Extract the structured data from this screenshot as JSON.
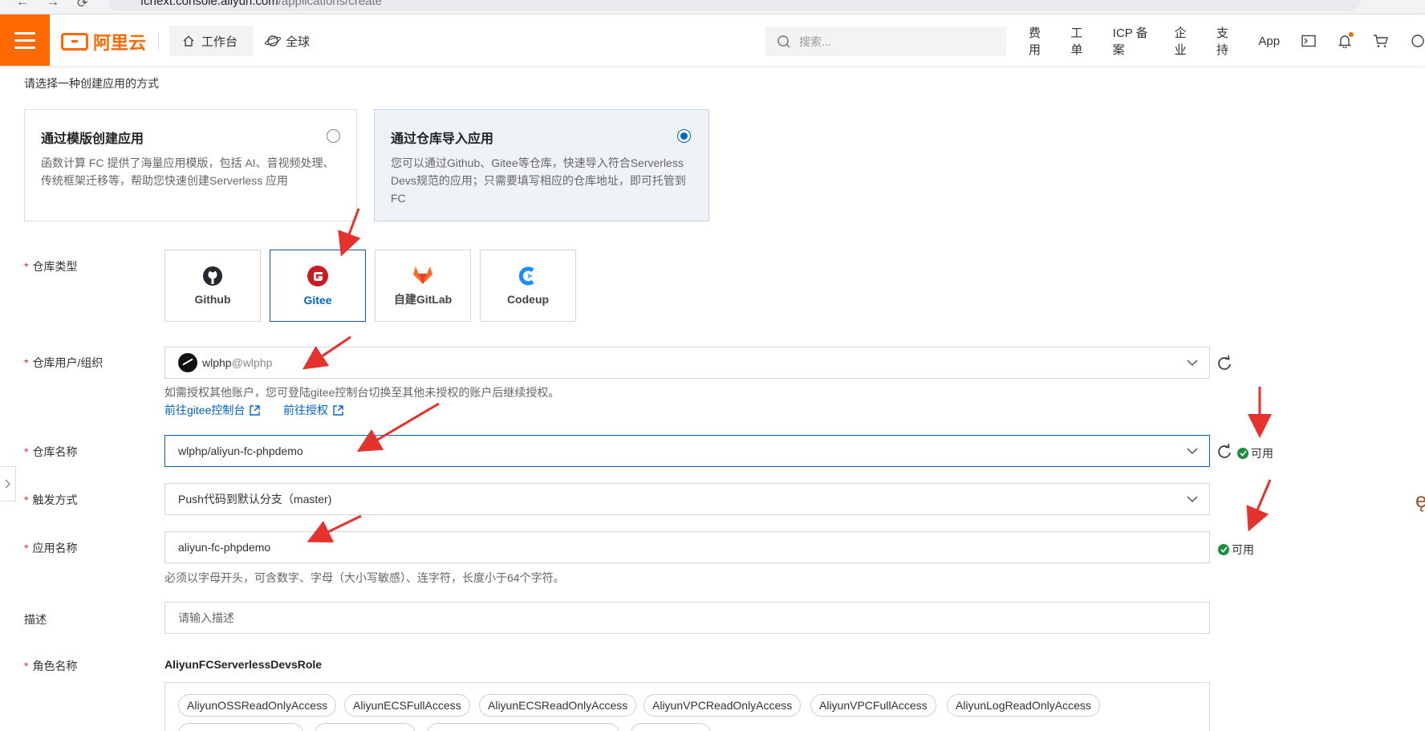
{
  "browser": {
    "url_host": "fcnext.console.aliyun.com",
    "url_path": "/applications/create"
  },
  "topbar": {
    "logo_text": "阿里云",
    "workbench_label": "工作台",
    "global_label": "全球",
    "search_placeholder": "搜索...",
    "nav": [
      "费用",
      "工单",
      "ICP 备案",
      "企业",
      "支持",
      "App"
    ],
    "brand_color": "#ff6a00"
  },
  "form": {
    "hint": "请选择一种创建应用的方式",
    "methods": [
      {
        "title": "通过模版创建应用",
        "desc": "函数计算 FC 提供了海量应用模版，包括 AI、音视频处理、传统框架迁移等，帮助您快速创建Serverless 应用",
        "selected": false
      },
      {
        "title": "通过仓库导入应用",
        "desc": "您可以通过Github、Gitee等仓库，快速导入符合Serverless Devs规范的应用；只需要填写相应的仓库地址，即可托管到 FC",
        "selected": true
      }
    ],
    "repo_type": {
      "label": "仓库类型",
      "options": [
        {
          "name": "Github",
          "icon": "github-icon",
          "selected": false
        },
        {
          "name": "Gitee",
          "icon": "gitee-icon",
          "selected": true
        },
        {
          "name": "自建GitLab",
          "icon": "gitlab-icon",
          "selected": false
        },
        {
          "name": "Codeup",
          "icon": "codeup-icon",
          "selected": false
        }
      ]
    },
    "repo_user": {
      "label": "仓库用户/组织",
      "value_user": "wlphp",
      "value_suffix": "@wlphp",
      "help": "如需授权其他账户，您可登陆gitee控制台切换至其他未授权的账户后继续授权。",
      "link_console": "前往gitee控制台",
      "link_auth": "前往授权"
    },
    "repo_name": {
      "label": "仓库名称",
      "value": "wlphp/aliyun-fc-phpdemo",
      "status": "可用"
    },
    "trigger": {
      "label": "触发方式",
      "value": "Push代码到默认分支（master)"
    },
    "app_name": {
      "label": "应用名称",
      "value": "aliyun-fc-phpdemo",
      "status": "可用",
      "help": "必须以字母开头，可含数字、字母（大小写敏感）、连字符，长度小于64个字符。"
    },
    "desc": {
      "label": "描述",
      "placeholder": "请输入描述"
    },
    "role": {
      "label": "角色名称",
      "value": "AliyunFCServerlessDevsRole",
      "policies": [
        "AliyunOSSReadOnlyAccess",
        "AliyunECSFullAccess",
        "AliyunECSReadOnlyAccess",
        "AliyunVPCReadOnlyAccess",
        "AliyunVPCFullAccess",
        "AliyunLogReadOnlyAccess"
      ]
    }
  },
  "colors": {
    "primary": "#0064c8",
    "required": "#d93026",
    "success": "#1e8e3e",
    "annotation": "#e5322d"
  }
}
